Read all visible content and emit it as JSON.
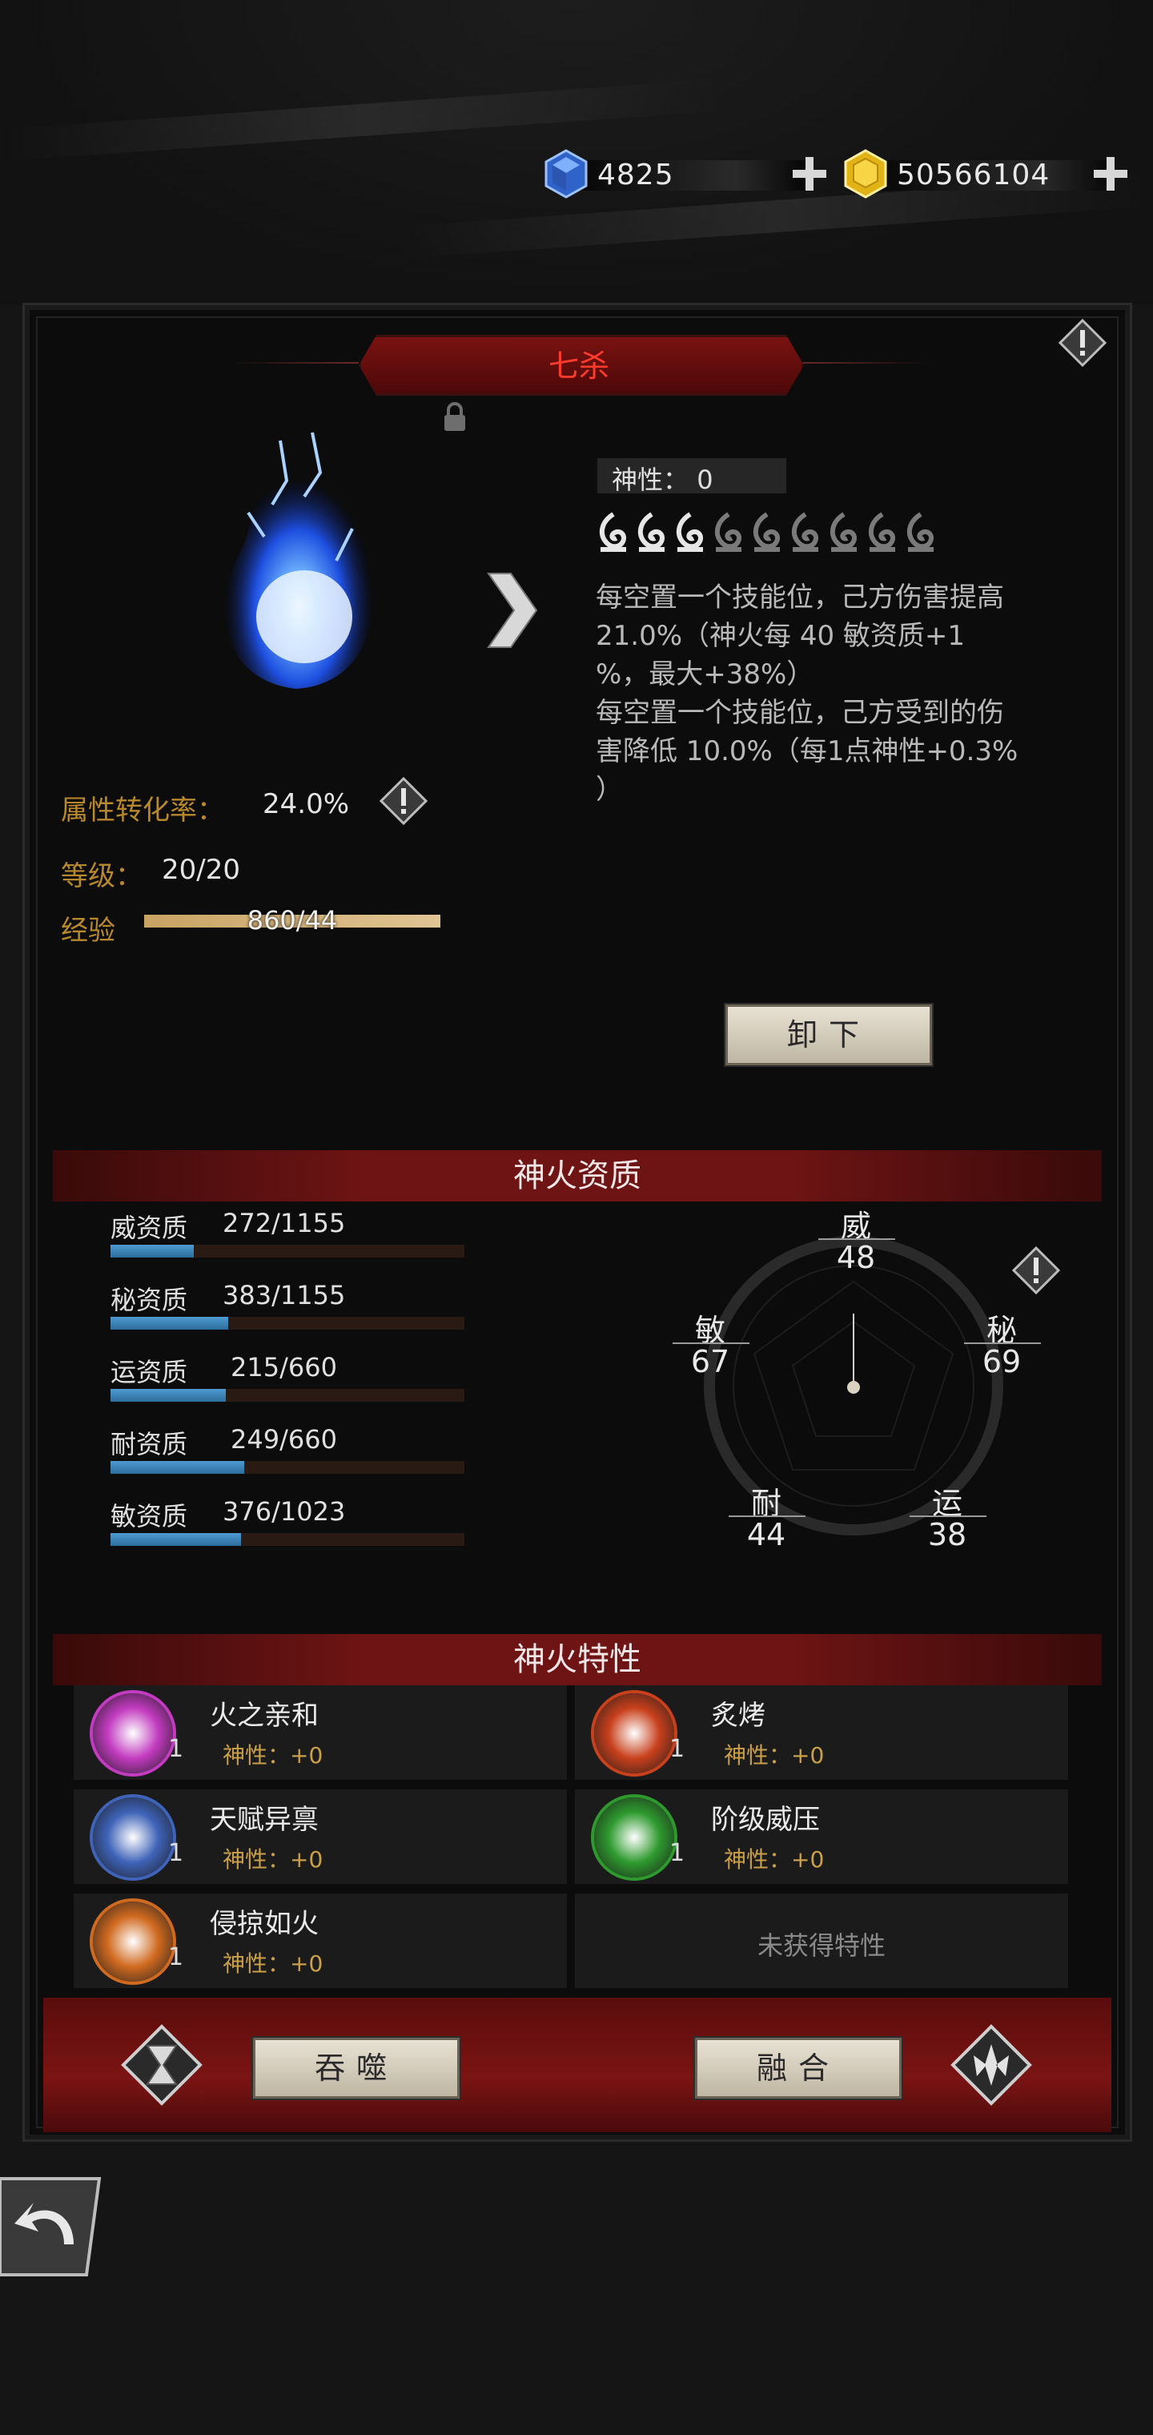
{
  "currency": {
    "gems": "4825",
    "gold": "50566104"
  },
  "fire": {
    "name": "七杀",
    "divinity_label": "神性：",
    "divinity_value": "0",
    "pips_filled": 3,
    "pips_total": 9,
    "desc1": "每空置一个技能位，己方伤害提高21.0%（神火每 40 敏资质+1%，最大+38%）",
    "desc1_lines": [
      "每空置一个技能位，己方伤害提高",
      "21.0%（神火每 40 敏资质+1",
      "%，最大+38%）"
    ],
    "desc2_lines": [
      "每空置一个技能位，己方受到的伤",
      "害降低 10.0%（每1点神性+0.3%",
      "）"
    ]
  },
  "stats": {
    "conversion_label": "属性转化率：",
    "conversion_value": "24.0%",
    "level_label": "等级：",
    "level_value": "20/20",
    "exp_label": "经验",
    "exp_value": "860/44",
    "exp_fraction": 1.0
  },
  "buttons": {
    "unequip": "卸下",
    "devour": "吞噬",
    "fuse": "融合"
  },
  "aptitude": {
    "title": "神火资质",
    "rows": [
      {
        "label": "威资质",
        "value": "272/1155",
        "fraction": 0.236
      },
      {
        "label": "秘资质",
        "value": "383/1155",
        "fraction": 0.332
      },
      {
        "label": "运资质",
        "value": "215/660",
        "fraction": 0.326
      },
      {
        "label": "耐资质",
        "value": "249/660",
        "fraction": 0.377
      },
      {
        "label": "敏资质",
        "value": "376/1023",
        "fraction": 0.368
      }
    ],
    "radar": {
      "wei": {
        "label": "威",
        "value": "48"
      },
      "mi": {
        "label": "秘",
        "value": "69"
      },
      "yun": {
        "label": "运",
        "value": "38"
      },
      "nai": {
        "label": "耐",
        "value": "44"
      },
      "min": {
        "label": "敏",
        "value": "67"
      }
    }
  },
  "traits": {
    "title": "神火特性",
    "items": [
      {
        "name": "火之亲和",
        "level": "1",
        "bonus": "神性：+0",
        "color": "#c23bc0"
      },
      {
        "name": "炙烤",
        "level": "1",
        "bonus": "神性：+0",
        "color": "#c8401c"
      },
      {
        "name": "天赋异禀",
        "level": "1",
        "bonus": "神性：+0",
        "color": "#3f63b8"
      },
      {
        "name": "阶级威压",
        "level": "1",
        "bonus": "神性：+0",
        "color": "#2e9a2e"
      },
      {
        "name": "侵掠如火",
        "level": "1",
        "bonus": "神性：+0",
        "color": "#d06a20"
      }
    ],
    "empty": "未获得特性"
  }
}
